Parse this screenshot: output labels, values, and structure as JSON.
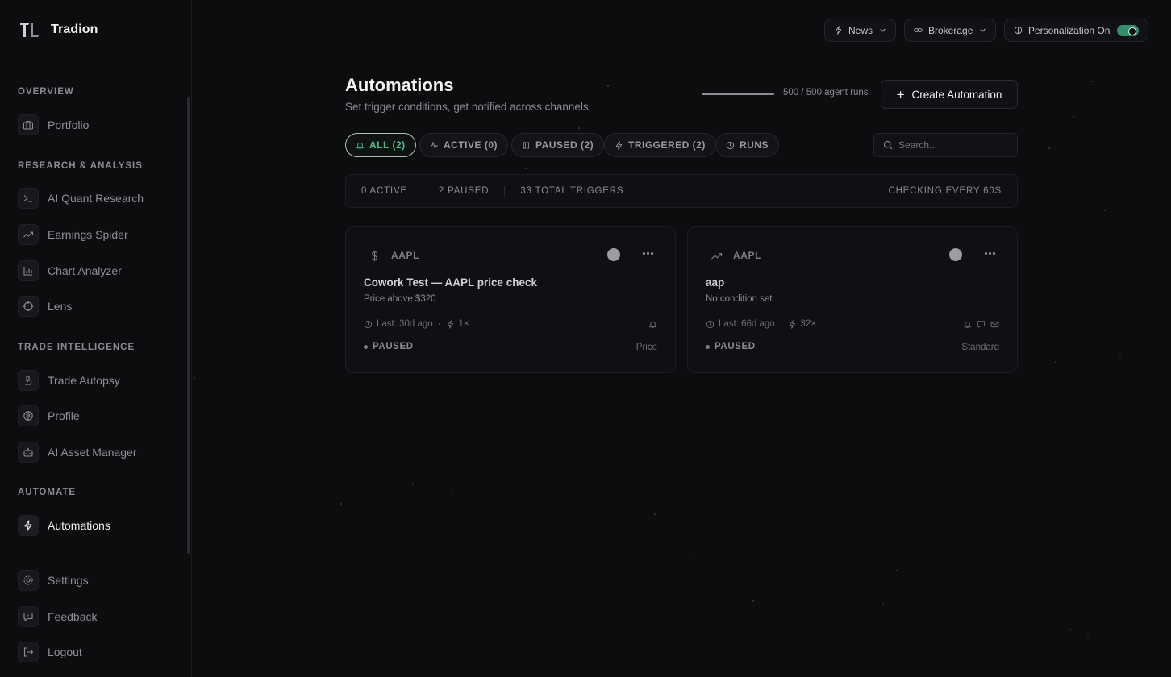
{
  "brand": {
    "name": "Tradion"
  },
  "topbar": {
    "news_label": "News",
    "brokerage_label": "Brokerage",
    "personalization_label": "Personalization On"
  },
  "sidebar": {
    "sections": {
      "overview": "OVERVIEW",
      "research": "RESEARCH & ANALYSIS",
      "trade": "TRADE INTELLIGENCE",
      "automate": "AUTOMATE"
    },
    "items": {
      "portfolio": "Portfolio",
      "ai_quant": "AI Quant Research",
      "earnings": "Earnings Spider",
      "chart": "Chart Analyzer",
      "lens": "Lens",
      "autopsy": "Trade Autopsy",
      "profile": "Profile",
      "asset_manager": "AI Asset Manager",
      "automations": "Automations"
    },
    "bottom": {
      "settings": "Settings",
      "feedback": "Feedback",
      "logout": "Logout"
    }
  },
  "main": {
    "title": "Automations",
    "subtitle": "Set trigger conditions, get notified across channels.",
    "runs_text": "500 / 500 agent runs",
    "runs_fraction": 1.0,
    "create_label": "Create Automation",
    "tabs": {
      "all": "ALL (2)",
      "active": "ACTIVE (0)",
      "paused": "PAUSED (2)",
      "triggered": "TRIGGERED (2)",
      "runs": "RUNS"
    },
    "search_placeholder": "Search...",
    "stats": {
      "active": "0 ACTIVE",
      "paused": "2 PAUSED",
      "total": "33 TOTAL TRIGGERS",
      "interval": "CHECKING EVERY 60S"
    },
    "cards": [
      {
        "icon": "dollar-icon",
        "ticker": "AAPL",
        "title": "Cowork Test — AAPL price check",
        "description": "Price above $320",
        "last": "Last: 30d ago",
        "count": "1×",
        "status": "PAUSED",
        "kind": "Price"
      },
      {
        "icon": "trend-up-icon",
        "ticker": "AAPL",
        "title": "aap",
        "description": "No condition set",
        "last": "Last: 66d ago",
        "count": "32×",
        "status": "PAUSED",
        "kind": "Standard"
      }
    ]
  },
  "colors": {
    "background": "#0c0d0f",
    "accent_green": "#4fbf8a",
    "toggle_on": "#2f8f6b"
  }
}
